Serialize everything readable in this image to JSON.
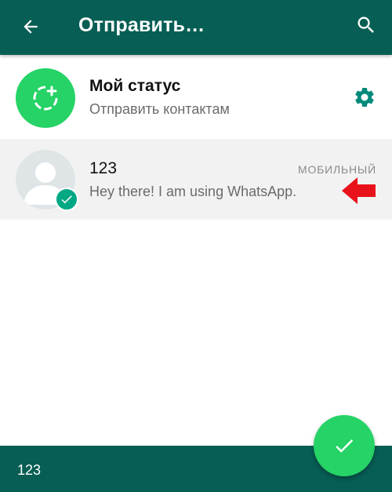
{
  "appbar": {
    "title": "Отправить…",
    "back_icon": "arrow-back-icon",
    "search_icon": "search-icon",
    "background": "#075e54"
  },
  "status_row": {
    "title": "Мой статус",
    "subtitle": "Отправить контактам",
    "avatar_icon": "add-status-icon",
    "settings_icon": "gear-icon",
    "accent": "#25d366"
  },
  "contacts": [
    {
      "name": "123",
      "about": "Hey there! I am using WhatsApp.",
      "phone_type": "МОБИЛЬНЫЙ",
      "selected": true,
      "highlight_arrow_color": "#e8121b"
    }
  ],
  "bottom_bar": {
    "selected_names": "123",
    "send_icon": "check-icon"
  }
}
